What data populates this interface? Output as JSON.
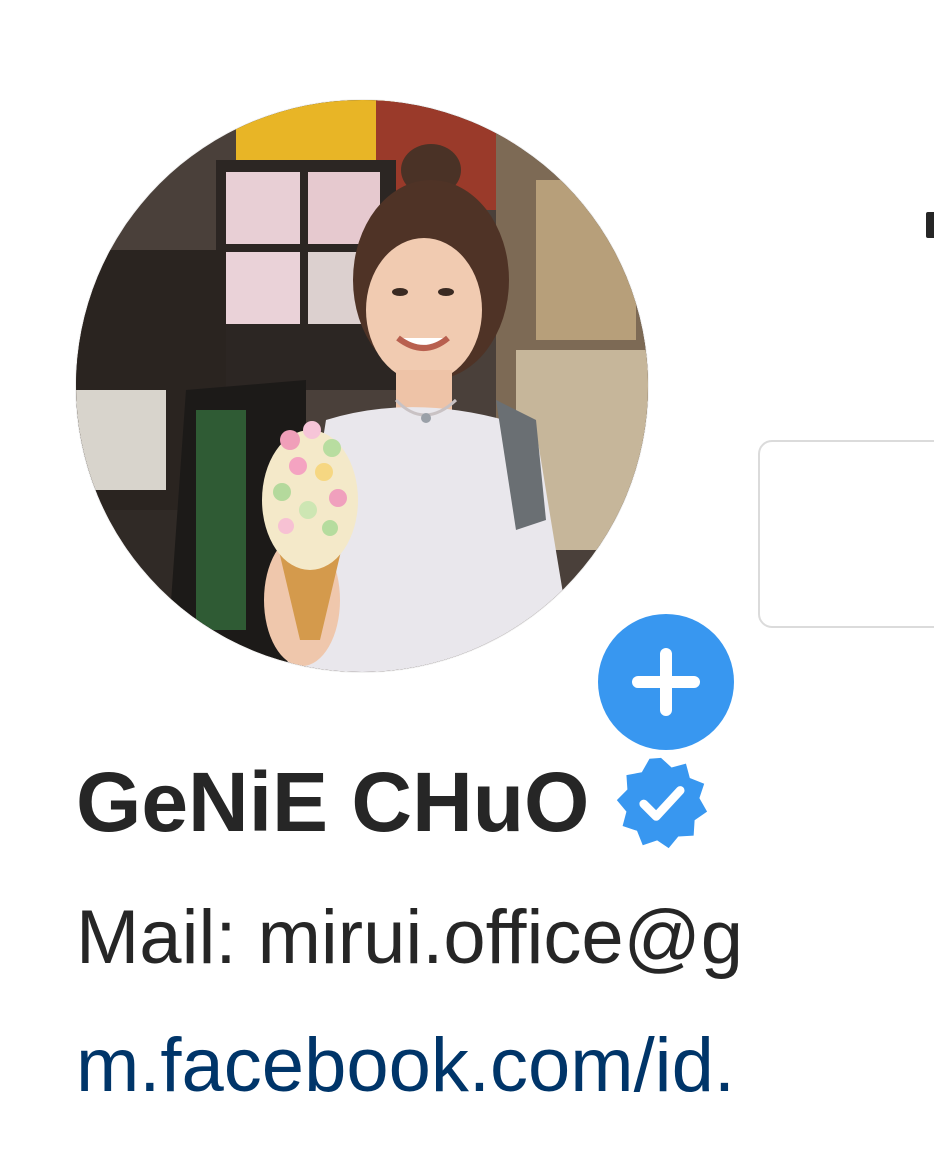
{
  "profile": {
    "avatar_alt": "profile-photo",
    "add_story_icon": "plus-icon",
    "verified_icon": "verified-badge-icon",
    "name": "GeNiE CHuO",
    "bio_mail": "Mail: mirui.office@g",
    "bio_link": "m.facebook.com/id."
  },
  "colors": {
    "accent": "#3897f0",
    "text": "#262626",
    "link": "#003569",
    "border": "#dbdbdb"
  }
}
